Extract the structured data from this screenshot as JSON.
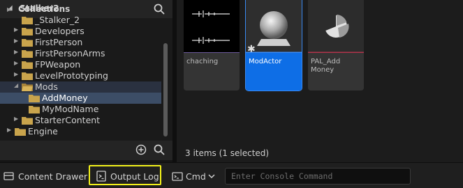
{
  "tree": {
    "root_label": "Stalker2",
    "items": [
      {
        "label": "_Stalker_2",
        "caret": ""
      },
      {
        "label": "Developers",
        "caret": "▶"
      },
      {
        "label": "FirstPerson",
        "caret": "▶"
      },
      {
        "label": "FirstPersonArms",
        "caret": "▶"
      },
      {
        "label": "FPWeapon",
        "caret": "▶"
      },
      {
        "label": "LevelPrototyping",
        "caret": "▶"
      },
      {
        "label": "Mods",
        "caret": "◢"
      },
      {
        "label": "AddMoney",
        "caret": ""
      },
      {
        "label": "MyModName",
        "caret": ""
      },
      {
        "label": "StarterContent",
        "caret": "▶"
      },
      {
        "label": "Engine",
        "caret": "▶"
      }
    ]
  },
  "collections": {
    "label": "Collections"
  },
  "assets": [
    {
      "label": "chaching",
      "type": "sound-wave",
      "accent": "#6b5a9c",
      "selected": false
    },
    {
      "label": "ModActor",
      "type": "actor-blueprint",
      "accent": "#3a8bf5",
      "selected": true
    },
    {
      "label": "PAL_Add Money",
      "type": "pie-asset",
      "accent": "#b3344c",
      "selected": false
    }
  ],
  "status": {
    "items": "3 items (1 selected)"
  },
  "bottom": {
    "drawer_label": "Content Drawer",
    "output_log_label": "Output Log",
    "cmd_label": "Cmd",
    "console_placeholder": "Enter Console Command"
  },
  "colors": {
    "highlight": "#f3f21a",
    "selection": "#1f6fe0",
    "folder": "#c9a44c"
  }
}
